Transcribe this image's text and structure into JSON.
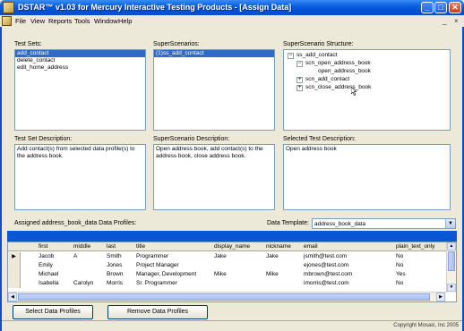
{
  "window": {
    "title": "DSTAR™ v1.03 for Mercury Interactive Testing Products - [Assign Data]",
    "controls": {
      "minimize": "_",
      "maximize": "□",
      "close": "✕"
    },
    "accent_color": "#0a56d6"
  },
  "menu": {
    "items": [
      "File",
      "View",
      "Reports",
      "Tools",
      "Window",
      "Help"
    ],
    "mdi_controls": {
      "minimize": "_",
      "restore": "×"
    }
  },
  "test_sets": {
    "label": "Test Sets:",
    "items": [
      "add_contact",
      "delete_contact",
      "edit_home_address"
    ],
    "selected_index": 0
  },
  "superscenarios": {
    "label": "SuperScenarios:",
    "items": [
      "(1)ss_add_contact"
    ],
    "selected_index": 0
  },
  "structure": {
    "label": "SuperScenario Structure:",
    "nodes": [
      {
        "text": "ss_add_contact",
        "expander": "−"
      },
      {
        "text": "scn_open_address_book",
        "expander": "−"
      },
      {
        "text": "open_address_book",
        "expander": ""
      },
      {
        "text": "scn_add_contact",
        "expander": "+"
      },
      {
        "text": "scn_close_address_book",
        "expander": "+"
      }
    ]
  },
  "test_set_description": {
    "label": "Test Set Description:",
    "text": "Add contact(s) from selected data profile(s) to the address book."
  },
  "superscenario_description": {
    "label": "SuperScenario Description:",
    "text": "Open address book, add contact(s) to the address book, close address book."
  },
  "selected_test_description": {
    "label": "Selected Test Description:",
    "text": "Open address book"
  },
  "profiles_label": "Assigned address_book_data Data Profiles:",
  "data_template": {
    "label": "Data Template:",
    "value": "address_book_data",
    "dropdown_arrow": "▼"
  },
  "grid": {
    "columns": [
      "first",
      "middle",
      "last",
      "title",
      "display_name",
      "nickname",
      "email",
      "plain_text_only"
    ],
    "rows": [
      [
        "Jacob",
        "A",
        "Smith",
        "Programmer",
        "Jake",
        "Jake",
        "jsmith@test.com",
        "No"
      ],
      [
        "Emily",
        "",
        "Jones",
        "Project Manager",
        "",
        "",
        "ejones@test.com",
        "No"
      ],
      [
        "Michael",
        "",
        "Brown",
        "Manager, Development",
        "Mike",
        "Mike",
        "mbrown@test.com",
        "Yes"
      ],
      [
        "Isabella",
        "Carolyn",
        "Morris",
        "Sr. Programmer",
        "",
        "",
        "imorris@test.com",
        "No"
      ]
    ],
    "current_row_marker": "▶",
    "scroll_glyphs": {
      "up": "▲",
      "down": "▼",
      "left": "◀",
      "right": "▶"
    }
  },
  "buttons": {
    "select_profiles": "Select Data Profiles",
    "remove_profiles": "Remove Data Profiles"
  },
  "status": {
    "copyright": "Copyright Mosaic, Inc 2005"
  }
}
